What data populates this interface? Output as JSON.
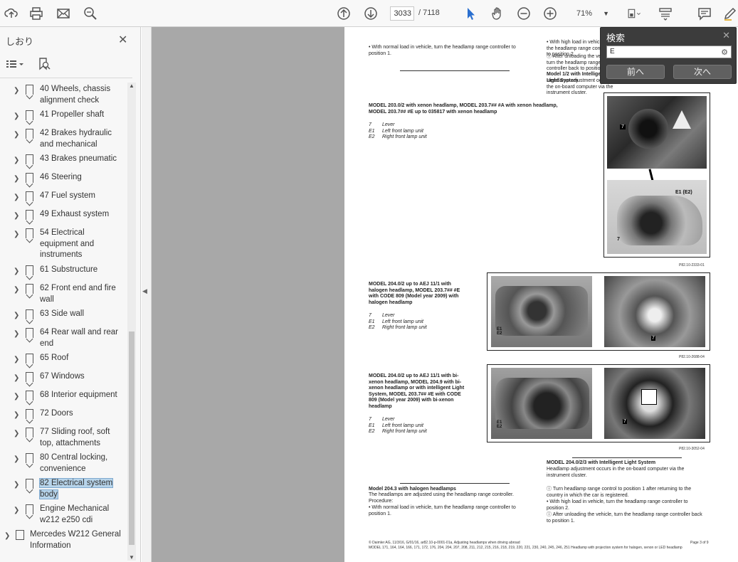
{
  "toolbar": {
    "page_current": "3033",
    "page_total": "/ 7118",
    "zoom": "71%"
  },
  "sidebar": {
    "title": "しおり",
    "bookmarks": [
      {
        "label": "40 Wheels, chassis alignment check"
      },
      {
        "label": "41 Propeller shaft"
      },
      {
        "label": "42 Brakes hydraulic and mechanical"
      },
      {
        "label": "43 Brakes pneumatic"
      },
      {
        "label": "46 Steering"
      },
      {
        "label": "47 Fuel system"
      },
      {
        "label": "49 Exhaust system"
      },
      {
        "label": "54 Electrical equipment and instruments"
      },
      {
        "label": "61 Substructure"
      },
      {
        "label": "62 Front end and fire wall"
      },
      {
        "label": "63 Side wall"
      },
      {
        "label": "64 Rear wall and rear end"
      },
      {
        "label": "65 Roof"
      },
      {
        "label": "67 Windows"
      },
      {
        "label": "68 Interior equipment"
      },
      {
        "label": "72 Doors"
      },
      {
        "label": "77 Sliding roof, soft top, attachments"
      },
      {
        "label": "80 Central locking, convenience"
      },
      {
        "label": "82 Electrical system body"
      },
      {
        "label": "Engine Mechanical w212 e250 cdi"
      }
    ],
    "root_item": "Mercedes W212 General Information"
  },
  "search": {
    "title": "検索",
    "value": "E",
    "prev_label": "前へ",
    "next_label": "次へ"
  },
  "pdf": {
    "top_left_bullet": "With normal load in vehicle, turn the headlamp range controller to position 1.",
    "top_right_bullet": "With high load in vehicle, turn the headlamp range controller to position 2.",
    "top_right_note": "After unloading the vehicle, turn the headlamp range controller back to position 1.",
    "top_right_heading": "Model 1/2 with Intelligent Light System",
    "top_right_line2": "Headlamp adjustment occurs in the on-board computer via the instrument cluster.",
    "sec1_heading": "MODEL 203.0/2 with xenon headlamp, MODEL 203.7## #A with xenon headlamp, MODEL 203.7## #E up to 035817 with xenon headlamp",
    "sec1_items": [
      "7",
      "E1",
      "E2"
    ],
    "sec1_desc": [
      "Lever",
      "Left front lamp unit",
      "Right front lamp unit"
    ],
    "sec1_code": "P82.10-2333-01",
    "sec2_heading": "MODEL 204.0/2 up to AEJ 11/1 with halogen headlamp, MODEL 203.7## #E with CODE 809 (Model year 2009) with halogen headlamp",
    "sec2_code": "P82.10-2688-04",
    "sec3_heading": "MODEL 204.0/2 up to AEJ 11/1 with bi-xenon headlamp, MODEL 204.9 with bi-xenon headlamp or with intelligent Light System, MODEL 203.7## #E with CODE 809 (Model year 2009) with bi-xenon headlamp",
    "sec3_code": "P82.10-3052-04",
    "sec4_heading": "Model 204.3 with halogen headlamps",
    "sec4_line1": "The headlamps are adjusted using the headlamp range controller.",
    "sec4_line2": "Procedure:",
    "sec4_bullet": "With normal load in vehicle, turn the headlamp range controller to position 1.",
    "sec5_heading": "MODEL 204.0/2/3 with Intelligent Light System",
    "sec5_line": "Headlamp adjustment occurs in the on-board computer via the instrument cluster.",
    "sec5_note1": "Turn headlamp range control to position 1 after returning to the country in which the car is registered.",
    "sec5_bullet": "With high load in vehicle, turn the headlamp range controller to position 2.",
    "sec5_note2": "After unloading the vehicle, turn the headlamp range controller back to position 1.",
    "footer_left": "© Daimler AG, 11/3/16, G/01/16, ar82.10-p-0001-01a, Adjusting headlamps when driving abroad",
    "footer_right": "Page 3 of 9",
    "footer_line2": "MODEL 171, 164, 164, 166, 171, 172, 176, 204, 204, 207, 208, 211, 212, 215, 216, 218, 219, 220, 221, 230, 240, 245, 246, 251 Headlamp with projection system for halogen, xenon or LED headlamp",
    "callout_7": "7",
    "callout_e1e2": "E1 (E2)",
    "callout_e1": "E1",
    "callout_e2": "E2"
  },
  "colors": {
    "toolbar_bg": "#f8f8f8",
    "viewer_bg": "#a8a8a8",
    "selected_bookmark": "#b7d4ea",
    "accent_cursor": "#2b6fcf"
  }
}
